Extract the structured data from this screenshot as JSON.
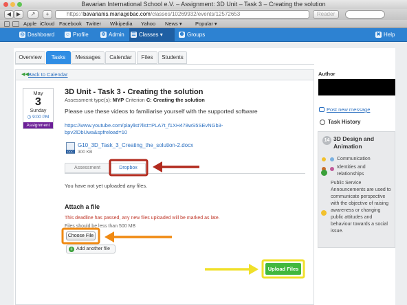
{
  "window": {
    "title": "Bavarian International School e.V. – Assignment: 3D Unit – Task 3 – Creating the solution"
  },
  "browser": {
    "url_scheme": "https",
    "url_domain": "bavarianis.managebac.com",
    "url_path": "/classes/10269932/events/12572653",
    "reader_label": "Reader",
    "nav_glyphs": {
      "back": "◀",
      "forward": "▶",
      "share": "↗",
      "add": "+"
    },
    "bookmarks": [
      "Apple",
      "iCloud",
      "Facebook",
      "Twitter",
      "Wikipedia",
      "Yahoo",
      "News ▾",
      "Popular ▾"
    ]
  },
  "appnav": {
    "items": [
      {
        "label": "Dashboard",
        "glyph": "◎"
      },
      {
        "label": "Profile",
        "glyph": "☺"
      },
      {
        "label": "Admin",
        "glyph": "⚙"
      },
      {
        "label": "Classes",
        "glyph": "☰"
      },
      {
        "label": "Groups",
        "glyph": "⚉"
      }
    ],
    "classes_caret": "▾",
    "help_label": "Help",
    "help_glyph": "✖"
  },
  "tabs": [
    "Overview",
    "Tasks",
    "Messages",
    "Calendar",
    "Files",
    "Students"
  ],
  "back_link": "Back to Calendar",
  "back_glyph": "◀◀",
  "calendar": {
    "month": "May",
    "day": "3",
    "weekday": "Sunday",
    "time": "◷ 9:00 PM",
    "badge": "Assignment"
  },
  "task": {
    "title": "3D Unit - Task 3 - Creating the solution",
    "assessment_prefix": "Assessment type(s):",
    "assessment_type": "MYP",
    "criterion_prefix": "Criterion",
    "criterion": "C: Creating the solution",
    "description": "Please use these videos to familiarise yourself with the supported software",
    "link": "https://www.youtube.com/playlist?list=PLA7t_f1XH478wS5SEvNGb3-bpv2lDbUwa&spfreload=10",
    "file": {
      "name": "G10_3D_Task_3_Creating_the_solution-2.docx",
      "size": "300 KB",
      "type": "DOC"
    }
  },
  "subtabs": [
    "Assessment",
    "Dropbox"
  ],
  "dropbox": {
    "not_uploaded": "You have not yet uploaded any files.",
    "attach_heading": "Attach a file",
    "deadline_warning": "This deadline has passed, any new files uploaded will be marked as late.",
    "size_note": "Files should be less than 500 MB",
    "choose_file": "Choose File",
    "add_another": "Add another file",
    "upload": "Upload Files"
  },
  "sidebar": {
    "author_label": "Author",
    "post_message": "Post new message",
    "task_history": "Task History",
    "unit_number": "14",
    "unit_title": "3D Design and Animation",
    "concepts": [
      "Communication",
      "Identities and relationships"
    ],
    "statement": "Public Service Announcements are used to communicate perspective with the objective of raising awareness or changing public attitudes and behaviour towards a social issue."
  },
  "colors": {
    "nav_blue": "#2d82d2",
    "active_tab": "#2f8de4",
    "assignment_badge": "#6b1e97",
    "upload_green": "#41b83d",
    "red_annotation": "#b22a1e",
    "orange_annotation": "#f08a12",
    "yellow_annotation": "#f0e02a"
  }
}
